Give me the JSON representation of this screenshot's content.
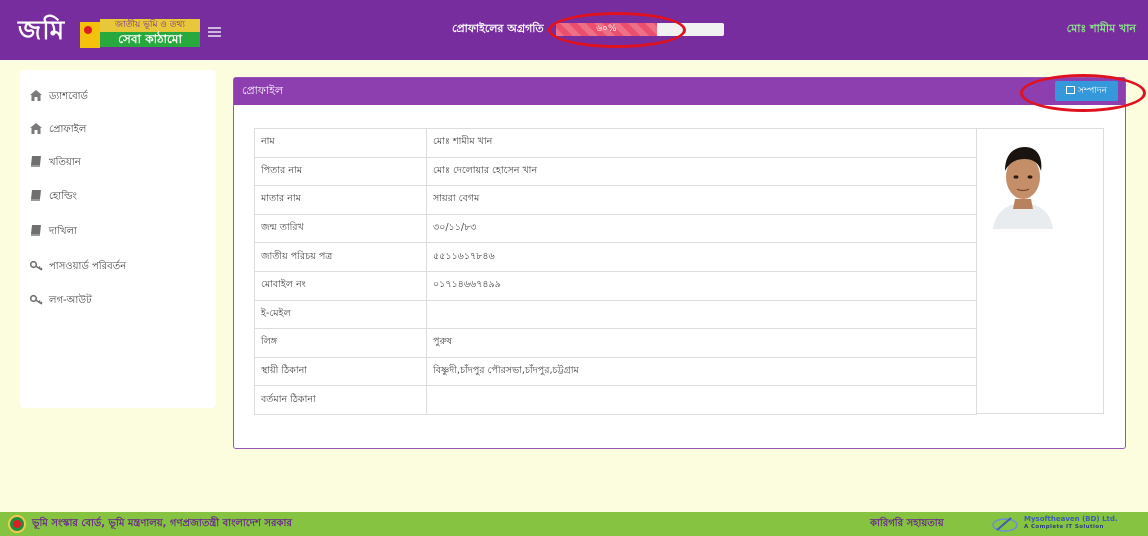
{
  "app": {
    "logo_main": "জমি",
    "logo_sub_top": "জাতীয় ভূমি ও তথ্য",
    "logo_sub_bottom": "সেবা কাঠামো"
  },
  "header": {
    "progress_label": "প্রোফাইলের অগ্রগতি",
    "progress_percent": 60,
    "progress_text": "৬০%",
    "username": "মোঃ শামীম খান"
  },
  "sidebar": {
    "items": [
      {
        "label": "ড্যাশবোর্ড",
        "icon": "home-icon"
      },
      {
        "label": "প্রোফাইল",
        "icon": "home-icon"
      },
      {
        "label": "খতিয়ান",
        "icon": "book-icon"
      },
      {
        "label": "হোল্ডিং",
        "icon": "book-icon"
      },
      {
        "label": "দাখিলা",
        "icon": "book-icon"
      },
      {
        "label": "পাসওয়ার্ড পরিবর্তন",
        "icon": "key-icon"
      },
      {
        "label": "লগ-আউট",
        "icon": "key-icon"
      }
    ]
  },
  "profile": {
    "title": "প্রোফাইল",
    "edit_label": "সম্পাদন",
    "rows": [
      {
        "label": "নাম",
        "value": "মোঃ শামীম খান"
      },
      {
        "label": "পিতার নাম",
        "value": "মোঃ দেলোয়ার হোসেন খান"
      },
      {
        "label": "মাতার নাম",
        "value": "সায়রা বেগম"
      },
      {
        "label": "জন্ম তারিখ",
        "value": "৩০/১১/৮৩"
      },
      {
        "label": "জাতীয় পরিচয় পত্র",
        "value": "৫৫১১৬১৭৮৪৬"
      },
      {
        "label": "মোবাইল নং",
        "value": "০১৭১৪৬৬৭৪৯৯"
      },
      {
        "label": "ই-মেইল",
        "value": ""
      },
      {
        "label": "লিঙ্গ",
        "value": "পুরুষ"
      },
      {
        "label": "স্থায়ী ঠিকানা",
        "value": "বিষ্ণুদী,চাঁদপুর পৌরসভা,চাঁদপুর,চট্টগ্রাম"
      },
      {
        "label": "বর্তমান ঠিকানা",
        "value": ""
      }
    ]
  },
  "footer": {
    "left_text": "ভূমি সংস্কার বোর্ড, ভূমি মন্ত্রণালয়, গণপ্রজাতন্ত্রী বাংলাদেশ সরকার",
    "right_text": "কারিগরি সহায়তায়",
    "brand_name": "Mysoftheaven (BD) Ltd.",
    "brand_tagline": "A Complete IT Solution"
  },
  "colors": {
    "header_bg": "#772d9e",
    "panel_head_bg": "#8d3fb0",
    "progress_fill": "#ea4f6e",
    "edit_button": "#3498db",
    "footer_bg": "#85c341",
    "page_bg": "#fcfcde",
    "annotation_ring": "#e0121e"
  }
}
